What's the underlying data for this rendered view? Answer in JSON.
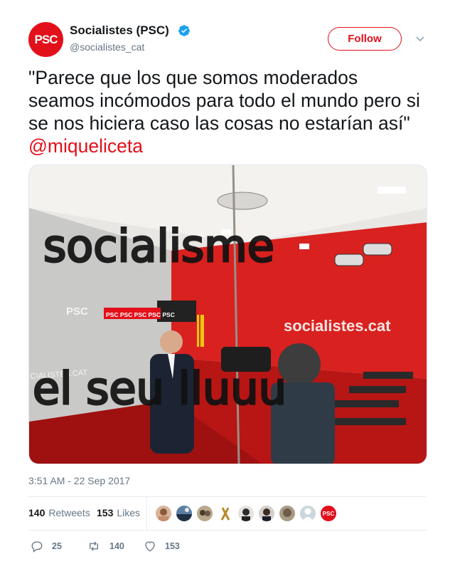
{
  "author": {
    "name": "Socialistes (PSC)",
    "handle": "@socialistes_cat",
    "avatar_text": "PSC",
    "verified": true
  },
  "follow_label": "Follow",
  "tweet": {
    "text": "\"Parece que los que somos moderados seamos incómodos para todo el mundo pero si se nos hiciera caso las cosas no estarían así\" ",
    "mention": "@miqueliceta"
  },
  "media": {
    "wall_logo": "PSC",
    "banner_text": "PSC PSC PSC PSC PSC",
    "wall_text": "socialistes.cat",
    "side_text": "CIALISTES.CAT",
    "scribble_top": "socialisme",
    "scribble_bottom": "el seu lluuu"
  },
  "timestamp": "3:51 AM - 22 Sep 2017",
  "stats": {
    "retweets_count": "140",
    "retweets_label": "Retweets",
    "likes_count": "153",
    "likes_label": "Likes"
  },
  "likers": [
    "user-1",
    "user-2",
    "user-3",
    "ribbon",
    "user-5",
    "user-6",
    "user-7",
    "default-avatar",
    "psc-logo"
  ],
  "actions": {
    "reply_count": "25",
    "retweet_count": "140",
    "like_count": "153"
  },
  "colors": {
    "brand": "#e2101b",
    "text": "#14171a",
    "muted": "#657786",
    "verified": "#1da1f2"
  }
}
